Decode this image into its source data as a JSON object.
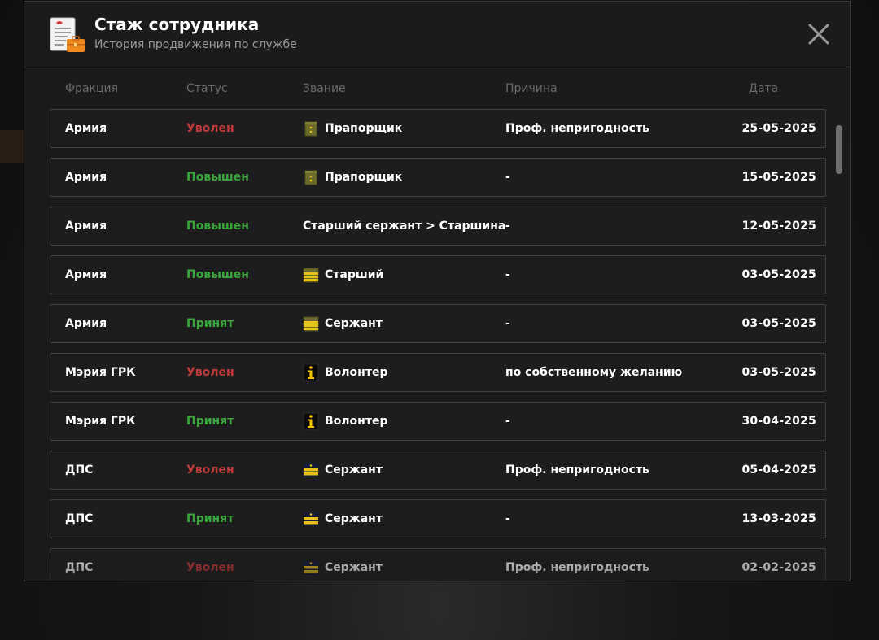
{
  "header": {
    "title": "Стаж сотрудника",
    "subtitle": "История продвижения по службе",
    "icon": "document-briefcase-icon",
    "close_icon": "close-icon"
  },
  "columns": {
    "faction": "Фракция",
    "status": "Статус",
    "rank": "Звание",
    "reason": "Причина",
    "date": "Дата"
  },
  "rows": [
    {
      "faction": "Армия",
      "status": "Уволен",
      "status_type": "fired",
      "rank": "Прапорщик",
      "rank_icon": "army-warrant-icon",
      "reason": "Проф. непригодность",
      "date": "25-05-2025"
    },
    {
      "faction": "Армия",
      "status": "Повышен",
      "status_type": "promoted",
      "rank": "Прапорщик",
      "rank_icon": "army-warrant-icon",
      "reason": "-",
      "date": "15-05-2025"
    },
    {
      "faction": "Армия",
      "status": "Повышен",
      "status_type": "promoted",
      "rank": "Старший сержант > Старшина",
      "rank_icon": "",
      "reason": "-",
      "date": "12-05-2025"
    },
    {
      "faction": "Армия",
      "status": "Повышен",
      "status_type": "promoted",
      "rank": "Старший",
      "rank_icon": "army-stripes-icon",
      "reason": "-",
      "date": "03-05-2025"
    },
    {
      "faction": "Армия",
      "status": "Принят",
      "status_type": "hired",
      "rank": "Сержант",
      "rank_icon": "army-stripes-icon",
      "reason": "-",
      "date": "03-05-2025"
    },
    {
      "faction": "Мэрия ГРК",
      "status": "Уволен",
      "status_type": "fired",
      "rank": "Волонтер",
      "rank_icon": "volunteer-info-icon",
      "reason": "по собственному желанию",
      "date": "03-05-2025"
    },
    {
      "faction": "Мэрия ГРК",
      "status": "Принят",
      "status_type": "hired",
      "rank": "Волонтер",
      "rank_icon": "volunteer-info-icon",
      "reason": "-",
      "date": "30-04-2025"
    },
    {
      "faction": "ДПС",
      "status": "Уволен",
      "status_type": "fired",
      "rank": "Сержант",
      "rank_icon": "dps-stripes-icon",
      "reason": "Проф. непригодность",
      "date": "05-04-2025"
    },
    {
      "faction": "ДПС",
      "status": "Принят",
      "status_type": "hired",
      "rank": "Сержант",
      "rank_icon": "dps-stripes-icon",
      "reason": "-",
      "date": "13-03-2025"
    },
    {
      "faction": "ДПС",
      "status": "Уволен",
      "status_type": "fired",
      "rank": "Сержант",
      "rank_icon": "dps-stripes-icon",
      "reason": "Проф. непригодность",
      "date": "02-02-2025"
    }
  ],
  "colors": {
    "fired": "#c13a3a",
    "promoted": "#3aa53a",
    "hired": "#3aa53a",
    "army": "#6b6b2a",
    "gold": "#e8c21a"
  }
}
